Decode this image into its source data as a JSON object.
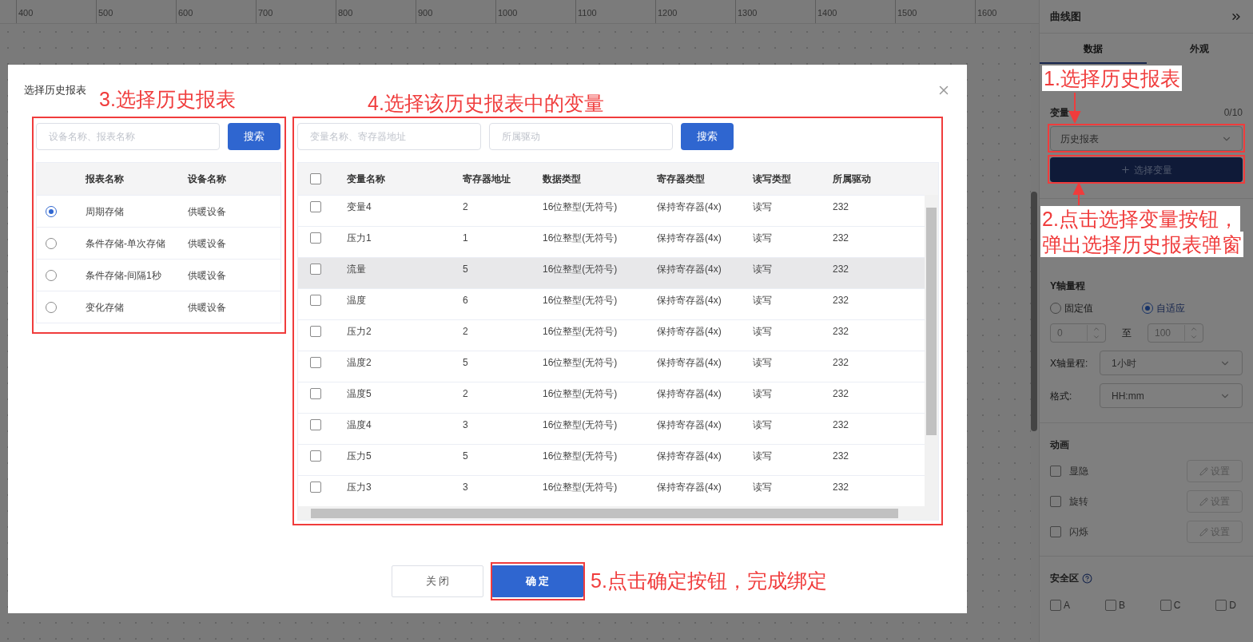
{
  "ruler": {
    "ticks": [
      "400",
      "500",
      "600",
      "700",
      "800",
      "900",
      "1000",
      "1100",
      "1200",
      "1300",
      "1400",
      "1500",
      "1600"
    ]
  },
  "right_panel": {
    "title": "曲线图",
    "tabs": [
      {
        "label": "数据",
        "selected": true
      },
      {
        "label": "外观",
        "selected": false
      }
    ],
    "variable": {
      "label": "变量",
      "count": "0/10",
      "source": "历史报表",
      "button": "选择变量"
    },
    "y_range": {
      "label": "Y轴量程",
      "options": [
        {
          "label": "固定值",
          "selected": false
        },
        {
          "label": "自适应",
          "selected": true
        }
      ],
      "min": "0",
      "to": "至",
      "max": "100"
    },
    "x_range": {
      "label": "X轴量程:",
      "value": "1小时"
    },
    "format": {
      "label": "格式:",
      "value": "HH:mm"
    },
    "animation": {
      "label": "动画",
      "items": [
        {
          "label": "显隐",
          "checked": false,
          "button": "设置"
        },
        {
          "label": "旋转",
          "checked": false,
          "button": "设置"
        },
        {
          "label": "闪烁",
          "checked": false,
          "button": "设置"
        }
      ]
    },
    "safe_zone": {
      "label": "安全区",
      "items": [
        {
          "label": "A",
          "checked": false
        },
        {
          "label": "B",
          "checked": false
        },
        {
          "label": "C",
          "checked": false
        },
        {
          "label": "D",
          "checked": false
        }
      ]
    }
  },
  "dialog": {
    "title": "选择历史报表",
    "report_search": {
      "placeholder": "设备名称、报表名称",
      "button": "搜索"
    },
    "report_table": {
      "columns": [
        "报表名称",
        "设备名称"
      ],
      "rows": [
        {
          "name": "周期存储",
          "device": "供暖设备",
          "selected": true
        },
        {
          "name": "条件存储-单次存储",
          "device": "供暖设备",
          "selected": false
        },
        {
          "name": "条件存储-间隔1秒",
          "device": "供暖设备",
          "selected": false
        },
        {
          "name": "变化存储",
          "device": "供暖设备",
          "selected": false
        }
      ]
    },
    "variable_search": {
      "placeholder": "变量名称、寄存器地址",
      "driver_placeholder": "所属驱动",
      "button": "搜索"
    },
    "variable_table": {
      "all_checked": false,
      "columns": [
        "变量名称",
        "寄存器地址",
        "数据类型",
        "寄存器类型",
        "读写类型",
        "所属驱动"
      ],
      "rows": [
        {
          "cells": [
            "变量4",
            "2",
            "16位整型(无符号)",
            "保持寄存器(4x)",
            "读写",
            "232"
          ],
          "checked": false,
          "hovered": false
        },
        {
          "cells": [
            "压力1",
            "1",
            "16位整型(无符号)",
            "保持寄存器(4x)",
            "读写",
            "232"
          ],
          "checked": false,
          "hovered": false
        },
        {
          "cells": [
            "流量",
            "5",
            "16位整型(无符号)",
            "保持寄存器(4x)",
            "读写",
            "232"
          ],
          "checked": false,
          "hovered": true
        },
        {
          "cells": [
            "温度",
            "6",
            "16位整型(无符号)",
            "保持寄存器(4x)",
            "读写",
            "232"
          ],
          "checked": false,
          "hovered": false
        },
        {
          "cells": [
            "压力2",
            "2",
            "16位整型(无符号)",
            "保持寄存器(4x)",
            "读写",
            "232"
          ],
          "checked": false,
          "hovered": false
        },
        {
          "cells": [
            "温度2",
            "5",
            "16位整型(无符号)",
            "保持寄存器(4x)",
            "读写",
            "232"
          ],
          "checked": false,
          "hovered": false
        },
        {
          "cells": [
            "温度5",
            "2",
            "16位整型(无符号)",
            "保持寄存器(4x)",
            "读写",
            "232"
          ],
          "checked": false,
          "hovered": false
        },
        {
          "cells": [
            "温度4",
            "3",
            "16位整型(无符号)",
            "保持寄存器(4x)",
            "读写",
            "232"
          ],
          "checked": false,
          "hovered": false
        },
        {
          "cells": [
            "压力5",
            "5",
            "16位整型(无符号)",
            "保持寄存器(4x)",
            "读写",
            "232"
          ],
          "checked": false,
          "hovered": false
        },
        {
          "cells": [
            "压力3",
            "3",
            "16位整型(无符号)",
            "保持寄存器(4x)",
            "读写",
            "232"
          ],
          "checked": false,
          "hovered": false
        }
      ]
    },
    "buttons": [
      {
        "label": "关 闭",
        "kind": "secondary"
      },
      {
        "label": "确 定",
        "kind": "primary"
      }
    ]
  },
  "annotations": [
    {
      "lines": [
        "1.选择历史报表"
      ]
    },
    {
      "lines": [
        "2.点击选择变量按钮，",
        "弹出选择历史报表弹窗"
      ]
    },
    {
      "lines": [
        "3.选择历史报表"
      ]
    },
    {
      "lines": [
        "4.选择该历史报表中的变量"
      ]
    },
    {
      "lines": [
        "5.点击确定按钮，完成绑定"
      ]
    }
  ]
}
